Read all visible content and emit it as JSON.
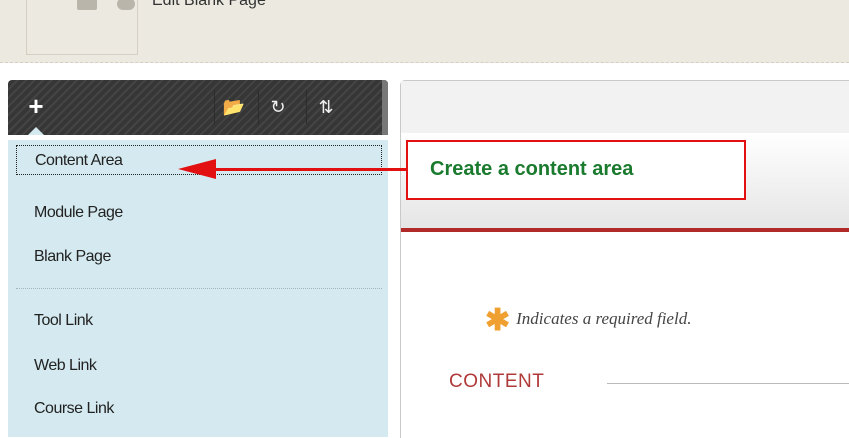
{
  "breadcrumb": {
    "title": "Edit Blank Page"
  },
  "toolbar": {
    "add_label": "+",
    "folder_icon": "📂",
    "refresh_icon": "↻",
    "sort_icon": "⇅"
  },
  "menu": {
    "items": [
      {
        "label": "Content Area"
      },
      {
        "label": "Module Page"
      },
      {
        "label": "Blank Page"
      },
      {
        "label": "Tool Link"
      },
      {
        "label": "Web Link"
      },
      {
        "label": "Course Link"
      }
    ]
  },
  "content": {
    "required_star": "✱",
    "required_text": "Indicates a required field.",
    "section_title": "CONTENT"
  },
  "annotation": {
    "callout_text": "Create a content area",
    "color": "#e21010",
    "text_color": "#1a7a2e"
  }
}
